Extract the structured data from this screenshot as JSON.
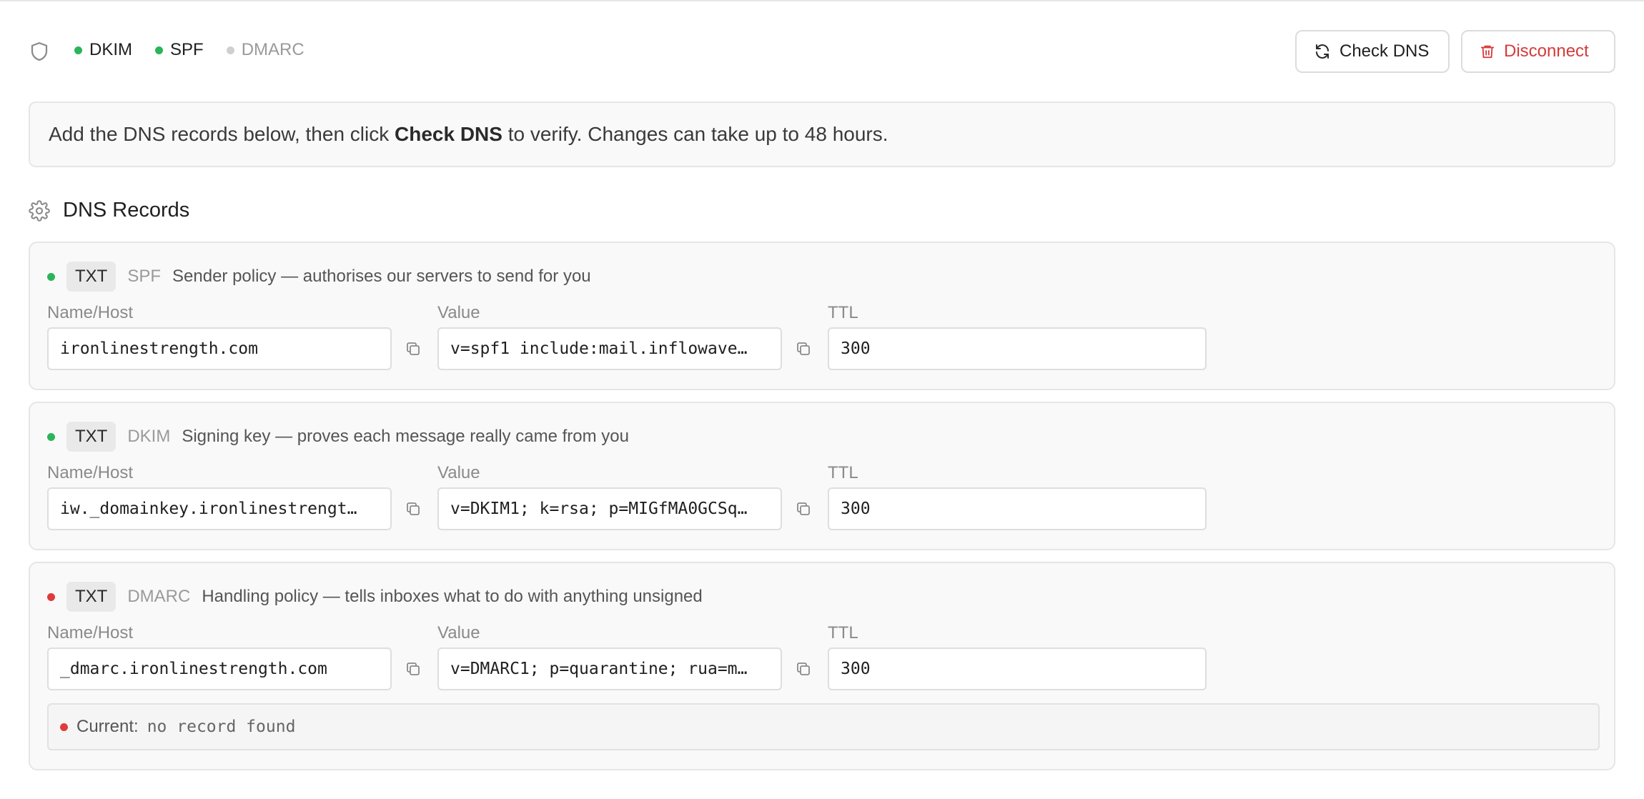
{
  "header": {
    "statuses": [
      {
        "label": "DKIM",
        "color": "#2bb45a"
      },
      {
        "label": "SPF",
        "color": "#2bb45a"
      },
      {
        "label": "DMARC",
        "color": "#cfcfcf"
      }
    ],
    "check_button": "Check DNS",
    "disconnect_button": "Disconnect"
  },
  "banner": {
    "before": "Add the DNS records below, then click ",
    "bold": "Check DNS",
    "after": " to verify. Changes can take up to 48 hours."
  },
  "section": {
    "title": "DNS Records"
  },
  "labels": {
    "name": "Name/Host",
    "value": "Value",
    "ttl": "TTL"
  },
  "records": [
    {
      "status_color": "#2bb45a",
      "type": "TXT",
      "kind": "SPF",
      "description": "Sender policy — authorises our servers to send for you",
      "name": "ironlinestrength.com",
      "value": "v=spf1 include:mail.inflowave…",
      "ttl": "300"
    },
    {
      "status_color": "#2bb45a",
      "type": "TXT",
      "kind": "DKIM",
      "description": "Signing key — proves each message really came from you",
      "name": "iw._domainkey.ironlinestrengt…",
      "value": "v=DKIM1; k=rsa; p=MIGfMA0GCSq…",
      "ttl": "300"
    },
    {
      "status_color": "#e03b3b",
      "type": "TXT",
      "kind": "DMARC",
      "description": "Handling policy — tells inboxes what to do with anything unsigned",
      "name": "_dmarc.ironlinestrength.com",
      "value": "v=DMARC1; p=quarantine; rua=m…",
      "ttl": "300",
      "current_label": "Current:",
      "current_value": "no record found"
    }
  ]
}
